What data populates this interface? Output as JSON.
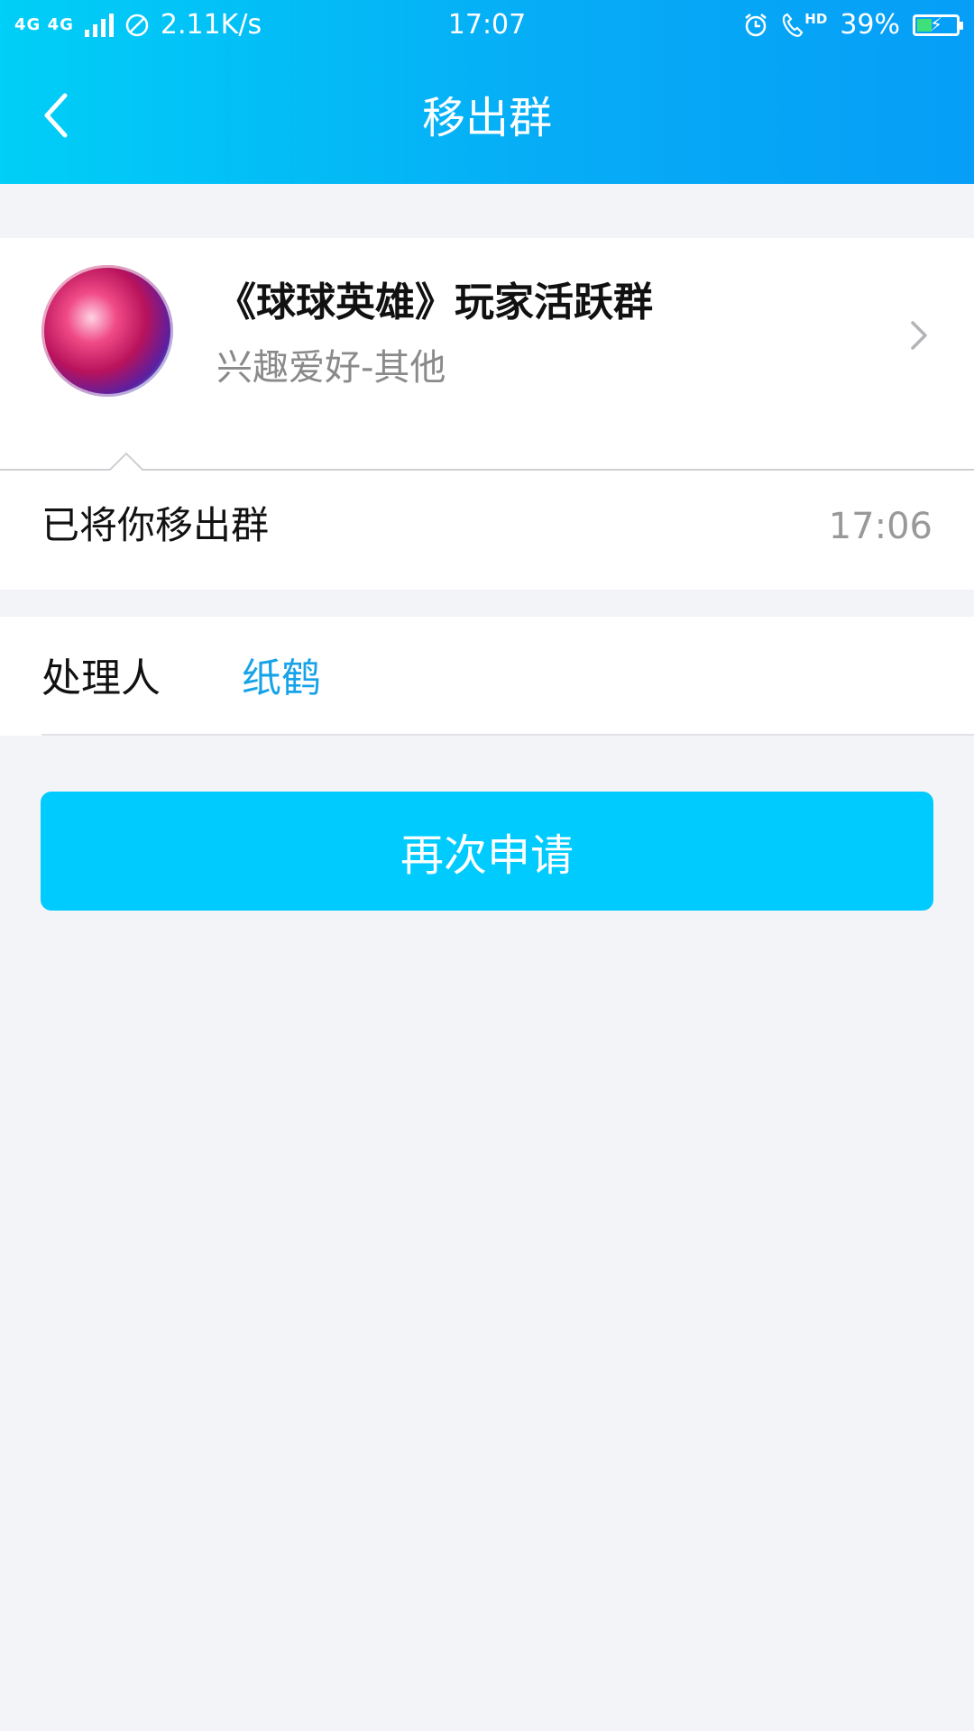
{
  "status_bar": {
    "network": "4G 4G",
    "speed": "2.11K/s",
    "time": "17:07",
    "call_badge": "HD",
    "battery": "39%",
    "battery_level": 0.39,
    "icons": [
      "signal-icon",
      "blocked-icon",
      "alarm-icon",
      "hd-call-icon",
      "battery-charging-icon"
    ]
  },
  "header": {
    "title": "移出群",
    "back_icon": "chevron-left-icon"
  },
  "group": {
    "name": "《球球英雄》玩家活跃群",
    "category": "兴趣爱好-其他",
    "avatar_icon": "group-avatar",
    "chevron_icon": "chevron-right-icon"
  },
  "notice": {
    "text": "已将你移出群",
    "time": "17:06"
  },
  "handler": {
    "label": "处理人",
    "name": "纸鹤"
  },
  "actions": {
    "reapply_label": "再次申请"
  },
  "colors": {
    "header_start": "#00cff7",
    "header_end": "#069ef7",
    "button": "#00cbff",
    "link": "#16a3e8",
    "background": "#f3f4f8"
  }
}
